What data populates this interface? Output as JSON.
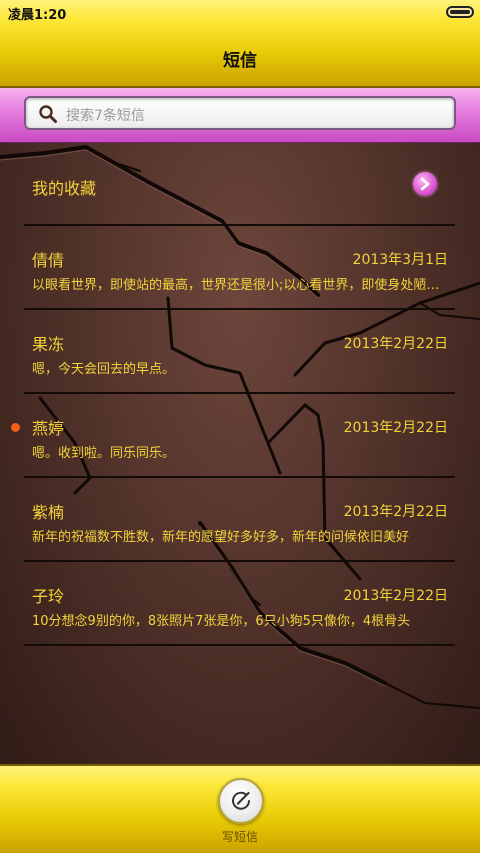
{
  "status_bar": {
    "time": "凌晨1:20"
  },
  "header": {
    "title": "短信"
  },
  "search": {
    "placeholder": "搜索7条短信"
  },
  "favorites": {
    "label": "我的收藏"
  },
  "conversations": [
    {
      "name": "倩倩",
      "date": "2013年3月1日",
      "preview": "以眼看世界，即使站的最高，世界还是很小;以心看世界，即使身处陋室，世界还是很大",
      "unread": false
    },
    {
      "name": "果冻",
      "date": "2013年2月22日",
      "preview": "嗯，今天会回去的早点。",
      "unread": false
    },
    {
      "name": "燕婷",
      "date": "2013年2月22日",
      "preview": "嗯。收到啦。同乐同乐。",
      "unread": true
    },
    {
      "name": "紫楠",
      "date": "2013年2月22日",
      "preview": "新年的祝福数不胜数，新年的愿望好多好多，新年的问候依旧美好",
      "unread": false
    },
    {
      "name": "子玲",
      "date": "2013年2月22日",
      "preview": "10分想念9别的你，8张照片7张是你，6只小狗5只像你，4根骨头",
      "unread": false
    }
  ],
  "compose": {
    "label": "写短信"
  },
  "colors": {
    "accent_yellow": "#f2d43a",
    "bar_yellow": "#e9cc06",
    "search_band_pink": "#e87fe0",
    "unread_orange": "#f2601a",
    "background_brown": "#52332b"
  },
  "icons": {
    "search": "search-icon",
    "arrow": "chevron-right-icon",
    "compose": "compose-icon",
    "battery": "battery-icon"
  }
}
